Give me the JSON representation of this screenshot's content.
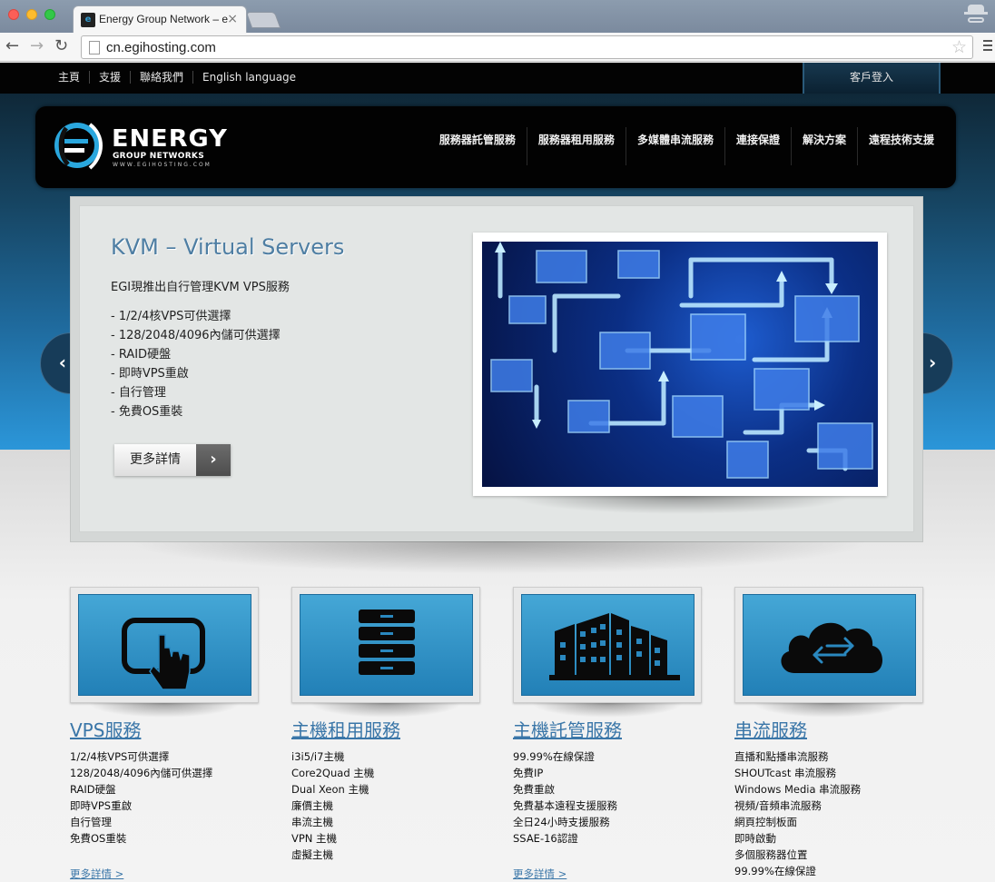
{
  "browser": {
    "tab_title": "Energy Group Network – eg",
    "tab_close": "×",
    "url": "cn.egihosting.com",
    "back": "←",
    "forward": "→",
    "reload": "↻",
    "star": "☆"
  },
  "topbar": {
    "items": [
      "主頁",
      "支援",
      "聯絡我們",
      "English language"
    ],
    "login": "客戶登入"
  },
  "logo": {
    "word": "ENERGY",
    "sub": "GROUP NETWORKS",
    "url": "WWW.EGIHOSTING.COM"
  },
  "mainnav": {
    "items": [
      "服務器託管服務",
      "服務器租用服務",
      "多媒體串流服務",
      "連接保證",
      "解決方案",
      "遠程技術支援"
    ]
  },
  "slide": {
    "title": "KVM – Virtual Servers",
    "intro": "EGI現推出自行管理KVM VPS服務",
    "list": [
      "- 1/2/4核VPS可供選擇",
      "- 128/2048/4096內儲可供選擇",
      "- RAID硬盤",
      "- 即時VPS重啟",
      "- 自行管理",
      "- 免費OS重裝"
    ],
    "button_label": "更多詳情",
    "button_arrow": "›",
    "prev": "‹",
    "next": "›"
  },
  "services": [
    {
      "title": "VPS服務",
      "icon": "touchscreen-hand-icon",
      "items": [
        "1/2/4核VPS可供選擇",
        "128/2048/4096內儲可供選擇",
        "RAID硬盤",
        "即時VPS重啟",
        "自行管理",
        "免費OS重裝"
      ],
      "more": "更多詳情 >"
    },
    {
      "title": "主機租用服務",
      "icon": "server-rack-icon",
      "items": [
        "i3i5/i7主機",
        "Core2Quad 主機",
        "Dual Xeon 主機",
        "廉價主機",
        "串流主機",
        "VPN 主機",
        "虛擬主機"
      ],
      "more": ""
    },
    {
      "title": "主機託管服務",
      "icon": "buildings-icon",
      "items": [
        "99.99%在線保證",
        "免費IP",
        "免費重啟",
        "免費基本遠程支援服務",
        "全日24小時支援服務",
        "SSAE-16認證"
      ],
      "more": "更多詳情 >"
    },
    {
      "title": "串流服務",
      "icon": "cloud-transfer-icon",
      "items": [
        "直播和點播串流服務",
        "SHOUTcast 串流服務",
        "Windows Media 串流服務",
        "視頻/音頻串流服務",
        "網頁控制板面",
        "即時啟動",
        "多個服務器位置",
        "99.99%在線保證"
      ],
      "more": ""
    }
  ],
  "colors": {
    "accent": "#3a76a8",
    "hero_top": "#0f2838",
    "hero_bottom": "#2b96d9",
    "panel": "#2280b7"
  }
}
